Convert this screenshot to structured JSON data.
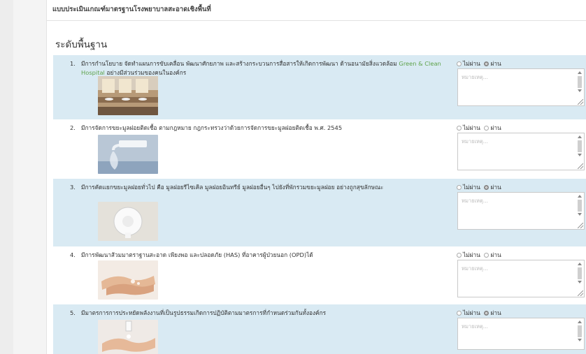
{
  "form": {
    "header": "แบบประเมินเกณฑ์มาตรฐานโรงพยาบาลสะอาดเชิงพื้นที่",
    "section_title": "ระดับพื้นฐาน",
    "remark_placeholder": "หมายเหตุ...",
    "radio_labels": {
      "fail": "ไม่ผ่าน",
      "pass": "ผ่าน"
    },
    "items": [
      {
        "num": "1.",
        "text_a": "มีการกำนโยบาย จัดทำแผนการขับเคลื่อน พัฒนาศักยภาพ และสร้างกระบวนการสื่อสารให้เกิดการพัฒนา ด้านอนามัยสิ่งแวดล้อม ",
        "text_green": "Green & Clean Hospital",
        "text_b": " อย่างมีส่วนร่วมของคนในองค์กร",
        "image_icon": "restroom-photo",
        "selected": "pass"
      },
      {
        "num": "2.",
        "text_a": "มีการจัดการขยะมูลฝอยติดเชื้อ ตามกฎหมาย กฎกระทรวงว่าด้วยการจัดการขยะมูลฝอยติดเชื้อ พ.ศ. 2545",
        "text_green": "",
        "text_b": "",
        "image_icon": "automatic-faucet-photo",
        "selected": "none"
      },
      {
        "num": "3.",
        "text_a": "มีการคัดแยกขยะมูลฝอยทั่วไป คือ มูลฝอยรีไซเคิล มูลฝอยอินทรีย์ มูลฝอยอื่นๆ ไปยังที่พักรวมขยะมูลฝอย อย่างถูกสุขลักษณะ",
        "text_green": "",
        "text_b": "",
        "image_icon": "tissue-dispenser-photo",
        "selected": "pass"
      },
      {
        "num": "4.",
        "text_a": "มีการพัฒนาส้วมมาตราฐานสะอาด เพียงพอ และปลอดภัย (HAS) ที่อาคารผู้ป่วยนอก (OPD)ได้",
        "text_green": "",
        "text_b": "",
        "image_icon": "hand-washing-photo",
        "selected": "none"
      },
      {
        "num": "5.",
        "text_a": "มีมาตรการการประหยัดพลังงานที่เป็นรูปธรรมเกิดการปฏิบัติตามมาตรการที่กำหนดร่วมกันทั้งองค์กร",
        "text_green": "",
        "text_b": "",
        "image_icon": "soap-dispenser-photo",
        "selected": "pass"
      }
    ]
  }
}
